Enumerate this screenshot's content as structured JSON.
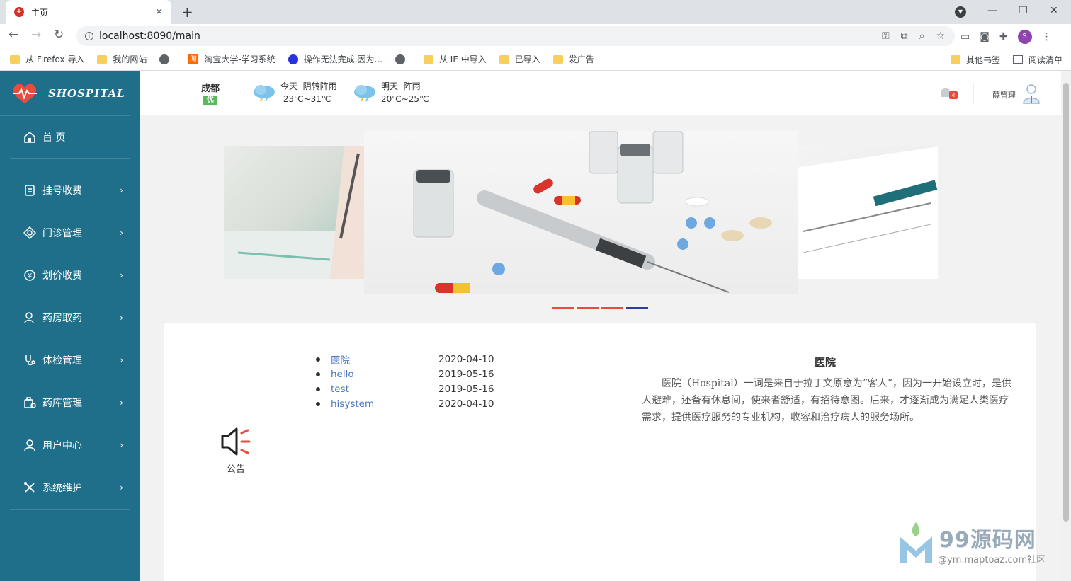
{
  "browser": {
    "tab_title": "主页",
    "url": "localhost:8090/main",
    "profile_initial": "S",
    "bookmarks": [
      "从 Firefox 导入",
      "我的网站",
      "淘宝大学-学习系统",
      "操作无法完成,因为...",
      "从 IE 中导入",
      "已导入",
      "发广告"
    ],
    "bookmarks_right": [
      "其他书签",
      "阅读清单"
    ],
    "taobao_glyph": "淘"
  },
  "sidebar": {
    "brand": "SHOSPITAL",
    "home": "首 页",
    "items": [
      {
        "label": "挂号收费",
        "icon": "register-icon"
      },
      {
        "label": "门诊管理",
        "icon": "clinic-icon"
      },
      {
        "label": "划价收费",
        "icon": "pricing-icon"
      },
      {
        "label": "药房取药",
        "icon": "pharmacy-icon"
      },
      {
        "label": "体检管理",
        "icon": "stethoscope-icon"
      },
      {
        "label": "药库管理",
        "icon": "warehouse-icon"
      },
      {
        "label": "用户中心",
        "icon": "user-icon"
      },
      {
        "label": "系统维护",
        "icon": "tools-icon"
      }
    ]
  },
  "header": {
    "city": "成都",
    "aqi": "优",
    "today": {
      "label": "今天",
      "weather": "阴转阵雨",
      "temp": "23℃~31℃"
    },
    "tomorrow": {
      "label": "明天",
      "weather": "阵雨",
      "temp": "20℃~25℃"
    },
    "notifications": "4",
    "user": "薛管理"
  },
  "carousel": {
    "slides": 4,
    "active_index": 3
  },
  "notice": {
    "label": "公告",
    "items": [
      {
        "title": "医院",
        "date": "2020-04-10"
      },
      {
        "title": "hello",
        "date": "2019-05-16"
      },
      {
        "title": "test",
        "date": "2019-05-16"
      },
      {
        "title": "hisystem",
        "date": "2020-04-10"
      }
    ]
  },
  "article": {
    "title": "医院",
    "body": "医院（Hospital）一词是来自于拉丁文原意为“客人”，因为一开始设立时，是供人避难，还备有休息间，使来者舒适，有招待意图。后来，才逐渐成为满足人类医疗需求，提供医疗服务的专业机构，收容和治疗病人的服务场所。"
  },
  "watermark": {
    "brand": "99源码网",
    "sub": "@ym.maptoaz.com社区"
  },
  "colors": {
    "sidebar": "#1f6f8b",
    "link": "#4a75c7",
    "dot": "#e74c3c",
    "dot_active": "#2c3e9e"
  }
}
